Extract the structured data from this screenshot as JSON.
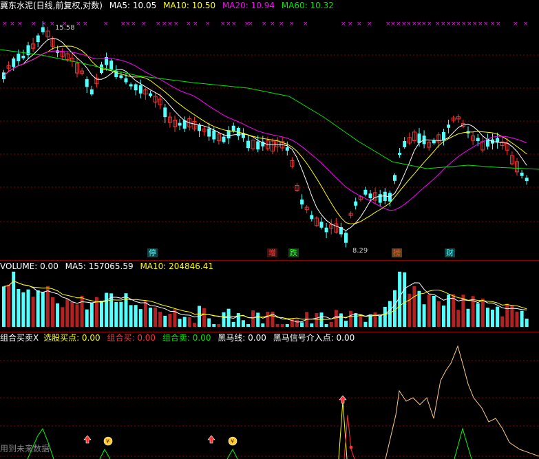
{
  "colors": {
    "bg": "#000000",
    "up": "#ff3232",
    "down": "#54ffff",
    "ma5": "#ffffff",
    "ma10": "#ffff00",
    "ma20": "#ff00ff",
    "ma60": "#00e600",
    "grid": "#8b0000"
  },
  "main": {
    "title": "冀东水泥(日线,前复权,对数)",
    "ma5_label": "MA5: 10.05",
    "ma10_label": "MA10: 10.50",
    "ma20_label": "MA20: 10.94",
    "ma60_label": "MA60: 10.32",
    "high_label": "15.58",
    "low_label": "8.29",
    "markers": [
      {
        "text": "停",
        "color": "#54ffff",
        "bg": "#114444"
      },
      {
        "text": "增",
        "color": "#ff4040",
        "bg": "#441111"
      },
      {
        "text": "跌",
        "color": "#40ff40",
        "bg": "#114411"
      },
      {
        "text": "榜",
        "color": "#ff4040",
        "bg": "#664411"
      },
      {
        "text": "财",
        "color": "#54ffff",
        "bg": "#114444"
      }
    ]
  },
  "volume": {
    "title": "VOLUME: 0.00",
    "ma5_label": "MA5: 157065.59",
    "ma10_label": "MA10: 204846.41"
  },
  "indicator": {
    "title": "组合买卖X",
    "pick_label": "选股买点: 0.00",
    "buy_label": "组合买: 0.00",
    "sell_label": "组合卖: 0.00",
    "horse_label": "黑马线: 0.00",
    "horse_signal_label": "黑马信号介入点: 0.00",
    "watermark": "用到未来数据"
  }
}
